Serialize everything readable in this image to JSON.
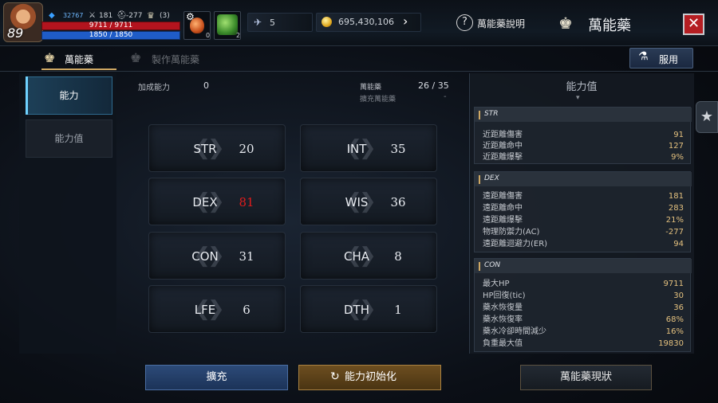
{
  "player": {
    "level": "89",
    "sp": "32767",
    "atk": "181",
    "ac": "-277",
    "trophy": "(3)",
    "hp": "9711 / 9711",
    "mp": "1850 / 1850"
  },
  "slots": {
    "slot1_count": "0",
    "slot2_count": "2"
  },
  "currency": {
    "tickets": "5",
    "gold": "695,430,106"
  },
  "header": {
    "help_label": "萬能藥說明",
    "title": "萬能藥",
    "close": "✕"
  },
  "tabs": {
    "main": "萬能藥",
    "make": "製作萬能藥",
    "use_button": "服用"
  },
  "side_tabs": {
    "ability": "能力",
    "stats": "能力值"
  },
  "summary": {
    "bonus_label": "加成能力",
    "bonus_value": "0",
    "potion_label": "萬能藥",
    "potion_value": "26 / 35",
    "expand_label": "擴充萬能藥",
    "expand_value": "-"
  },
  "stats": {
    "str": {
      "name": "STR",
      "value": "20"
    },
    "int": {
      "name": "INT",
      "value": "35"
    },
    "dex": {
      "name": "DEX",
      "value": "81"
    },
    "wis": {
      "name": "WIS",
      "value": "36"
    },
    "con": {
      "name": "CON",
      "value": "31"
    },
    "cha": {
      "name": "CHA",
      "value": "8"
    },
    "lfe": {
      "name": "LFE",
      "value": "6"
    },
    "dth": {
      "name": "DTH",
      "value": "1"
    }
  },
  "right_panel": {
    "title": "能力值",
    "groups": {
      "str": {
        "title": "STR",
        "rows": [
          {
            "k": "近距離傷害",
            "v": "91"
          },
          {
            "k": "近距離命中",
            "v": "127"
          },
          {
            "k": "近距離爆擊",
            "v": "9%"
          }
        ]
      },
      "dex": {
        "title": "DEX",
        "rows": [
          {
            "k": "遠距離傷害",
            "v": "181"
          },
          {
            "k": "遠距離命中",
            "v": "283"
          },
          {
            "k": "遠距離爆擊",
            "v": "21%"
          },
          {
            "k": "物理防禦力(AC)",
            "v": "-277"
          },
          {
            "k": "遠距離迴避力(ER)",
            "v": "94"
          }
        ]
      },
      "con": {
        "title": "CON",
        "rows": [
          {
            "k": "最大HP",
            "v": "9711"
          },
          {
            "k": "HP回復(tic)",
            "v": "30"
          },
          {
            "k": "藥水恢復量",
            "v": "36"
          },
          {
            "k": "藥水恢復率",
            "v": "68%"
          },
          {
            "k": "藥水冷卻時間減少",
            "v": "16%"
          },
          {
            "k": "負重最大值",
            "v": "19830"
          }
        ]
      }
    }
  },
  "buttons": {
    "expand": "擴充",
    "reset": "能力初始化",
    "status": "萬能藥現狀"
  },
  "colors": {
    "accent_gold": "#cfa863",
    "dex_highlight": "#e21c1c",
    "close_red": "#b51e22"
  }
}
